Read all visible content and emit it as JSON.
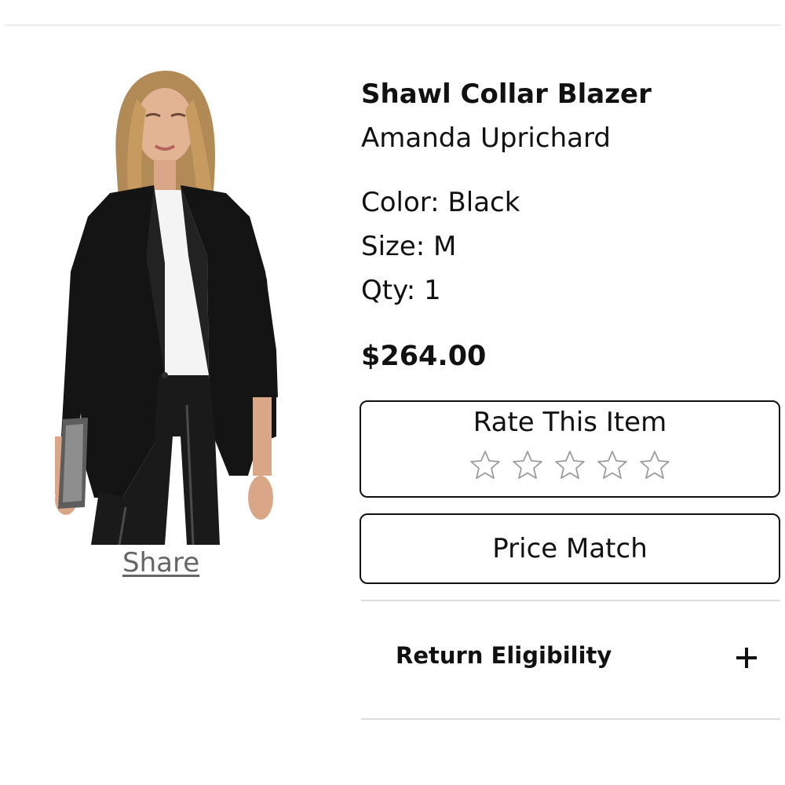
{
  "product": {
    "name": "Shawl Collar Blazer",
    "brand": "Amanda Uprichard",
    "color": "Color: Black",
    "size": "Size: M",
    "qty": "Qty: 1",
    "price": "$264.00",
    "image_alt_icon": "product-photo"
  },
  "share": {
    "label": "Share"
  },
  "rating": {
    "title": "Rate This Item",
    "max_stars": 5,
    "selected_stars": 0,
    "star_icon": "star-outline-icon"
  },
  "price_match": {
    "label": "Price Match"
  },
  "return_eligibility": {
    "label": "Return Eligibility",
    "toggle_icon": "plus-icon",
    "expanded": false
  },
  "colors": {
    "text": "#111111",
    "muted": "#666666",
    "divider": "#dddddd",
    "star_stroke": "#9a9a9a"
  }
}
